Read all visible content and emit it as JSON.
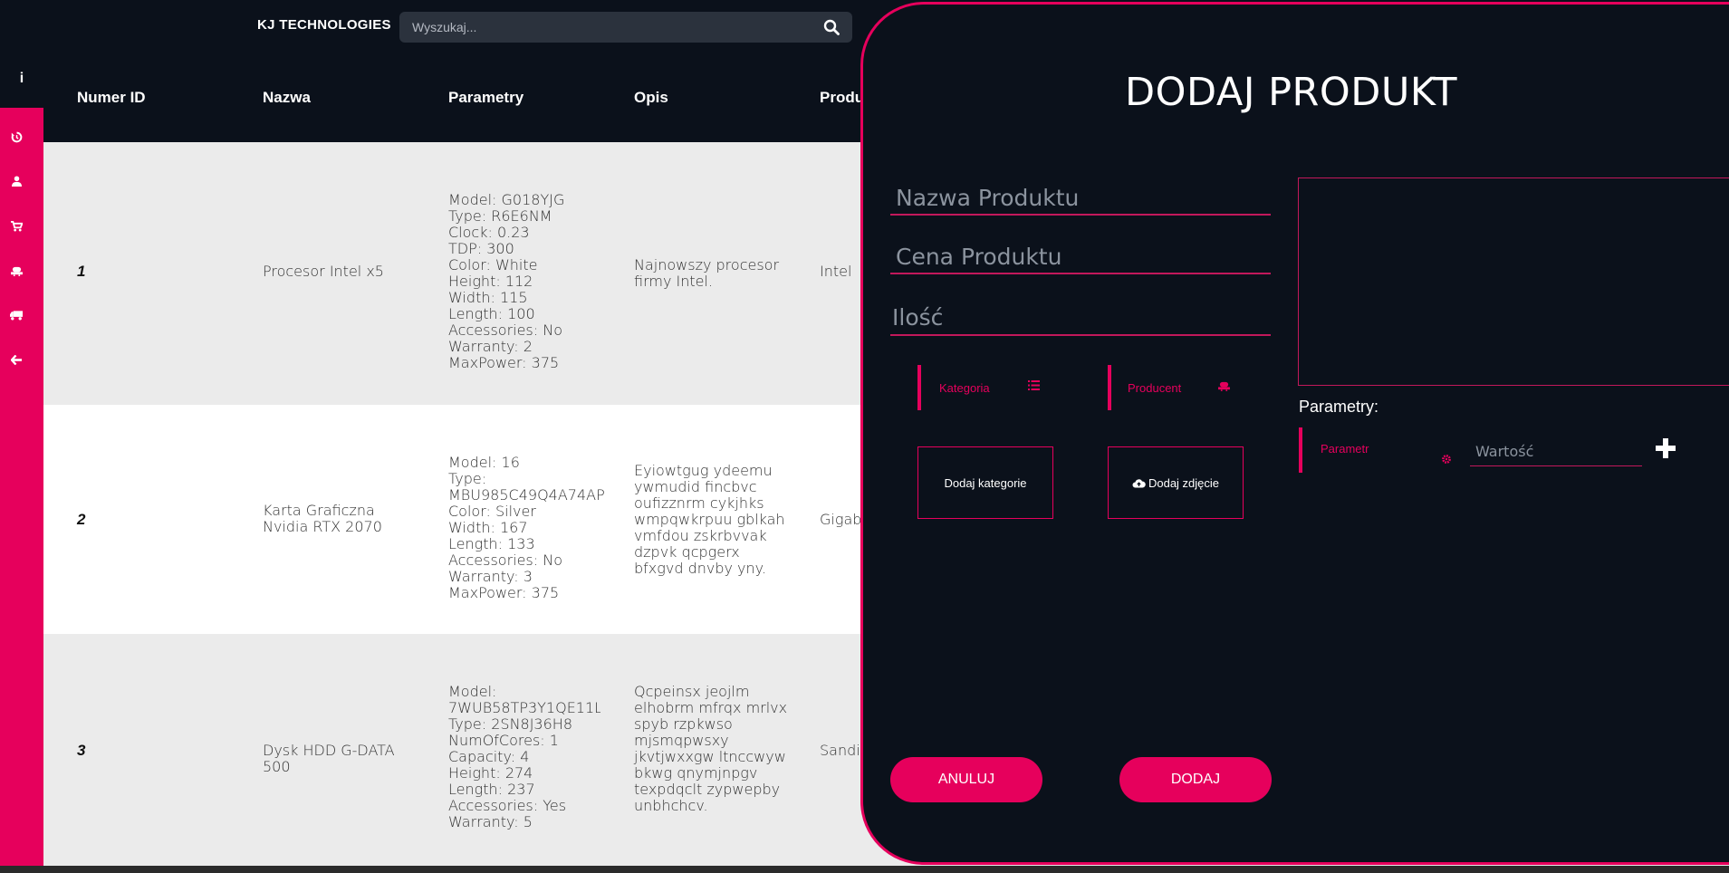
{
  "app": {
    "brand": "KJ TECHNOLOGIES"
  },
  "search": {
    "placeholder": "Wyszukaj..."
  },
  "sidebar": {
    "info_icon": "i",
    "items": [
      {
        "icon": "history-icon",
        "glyph": "⟲"
      },
      {
        "icon": "user-icon",
        "glyph": "👤"
      },
      {
        "icon": "cart-icon",
        "glyph": "🛒"
      },
      {
        "icon": "manufacturer-icon",
        "glyph": "⛁"
      },
      {
        "icon": "truck-icon",
        "glyph": "⛟"
      },
      {
        "icon": "arrow-left-icon",
        "glyph": "←"
      }
    ]
  },
  "table": {
    "headers": [
      "Numer ID",
      "Nazwa",
      "Parametry",
      "Opis",
      "Produ"
    ],
    "rows": [
      {
        "id": "1",
        "name": "Procesor Intel x5",
        "params": "Model: G018YJG\nType: R6E6NM\nClock: 0.23\nTDP: 300\nColor: White\nHeight: 112\nWidth: 115\nLength: 100\nAccessories: No\nWarranty: 2\nMaxPower: 375",
        "desc": "Najnowszy procesor firmy Intel.",
        "producer": "Intel"
      },
      {
        "id": "2",
        "name": "Karta Graficzna Nvidia RTX 2070",
        "params": "Model: 16\nType:\nMBU985C49Q4A74AP\nColor: Silver\nWidth: 167\nLength: 133\nAccessories: No\nWarranty: 3\nMaxPower: 375",
        "desc": "Eyiowtgug ydeemu ywmudid fincbvc oufizznrm cykjhks wmpqwkrpuu gblkah vmfdou zskrbvvak dzpvk qcpgerx bfxgvd dnvby yny.",
        "producer": "Gigaby"
      },
      {
        "id": "3",
        "name": "Dysk HDD G-DATA 500",
        "params": "Model:\n7WUB58TP3Y1QE11L1\nType: 2SN8J36H8\nNumOfCores: 1\nCapacity: 4\nHeight: 274\nLength: 237\nAccessories: Yes\nWarranty: 5",
        "desc": "Qcpeinsx jeojlm elhobrm mfrqx mrlvx spyb rzpkwso mjsmqpwsxy jkvtjwxxgw ltnccwyw bkwg qnymjnpgv texpdqclt zypwepby unbhchcv.",
        "producer": "Sandis"
      }
    ]
  },
  "modal": {
    "title": "DODAJ PRODUKT",
    "name_placeholder": "Nazwa Produktu",
    "price_placeholder": "Cena Produktu",
    "qty_placeholder": "Ilość",
    "category_label": "Kategoria",
    "producer_label": "Producent",
    "add_category": "Dodaj kategorie",
    "add_image": "Dodaj zdjęcie",
    "params_label": "Parametry:",
    "param_select": "Parametr",
    "value_placeholder": "Wartość",
    "cancel": "ANULUJ",
    "add": "DODAJ"
  },
  "colors": {
    "accent": "#e6005c",
    "background": "#0b111b",
    "row_alt": "#ebebeb"
  }
}
